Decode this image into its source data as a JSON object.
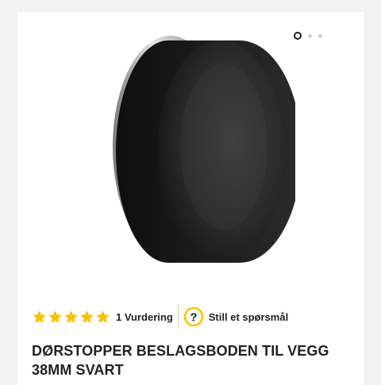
{
  "gallery": {
    "image_icon": "door-stopper-product-image",
    "slides_total": 3,
    "active_slide": 1
  },
  "rating": {
    "stars_filled": 5,
    "stars_total": 5,
    "star_color": "#f5c400",
    "review_count_label": "1 Vurdering"
  },
  "question": {
    "icon": "question-mark-icon",
    "icon_color": "#f5c400",
    "label": "Still et spørsmål"
  },
  "product": {
    "title": "DØRSTOPPER BESLAGSBODEN TIL VEGG 38MM SVART"
  }
}
